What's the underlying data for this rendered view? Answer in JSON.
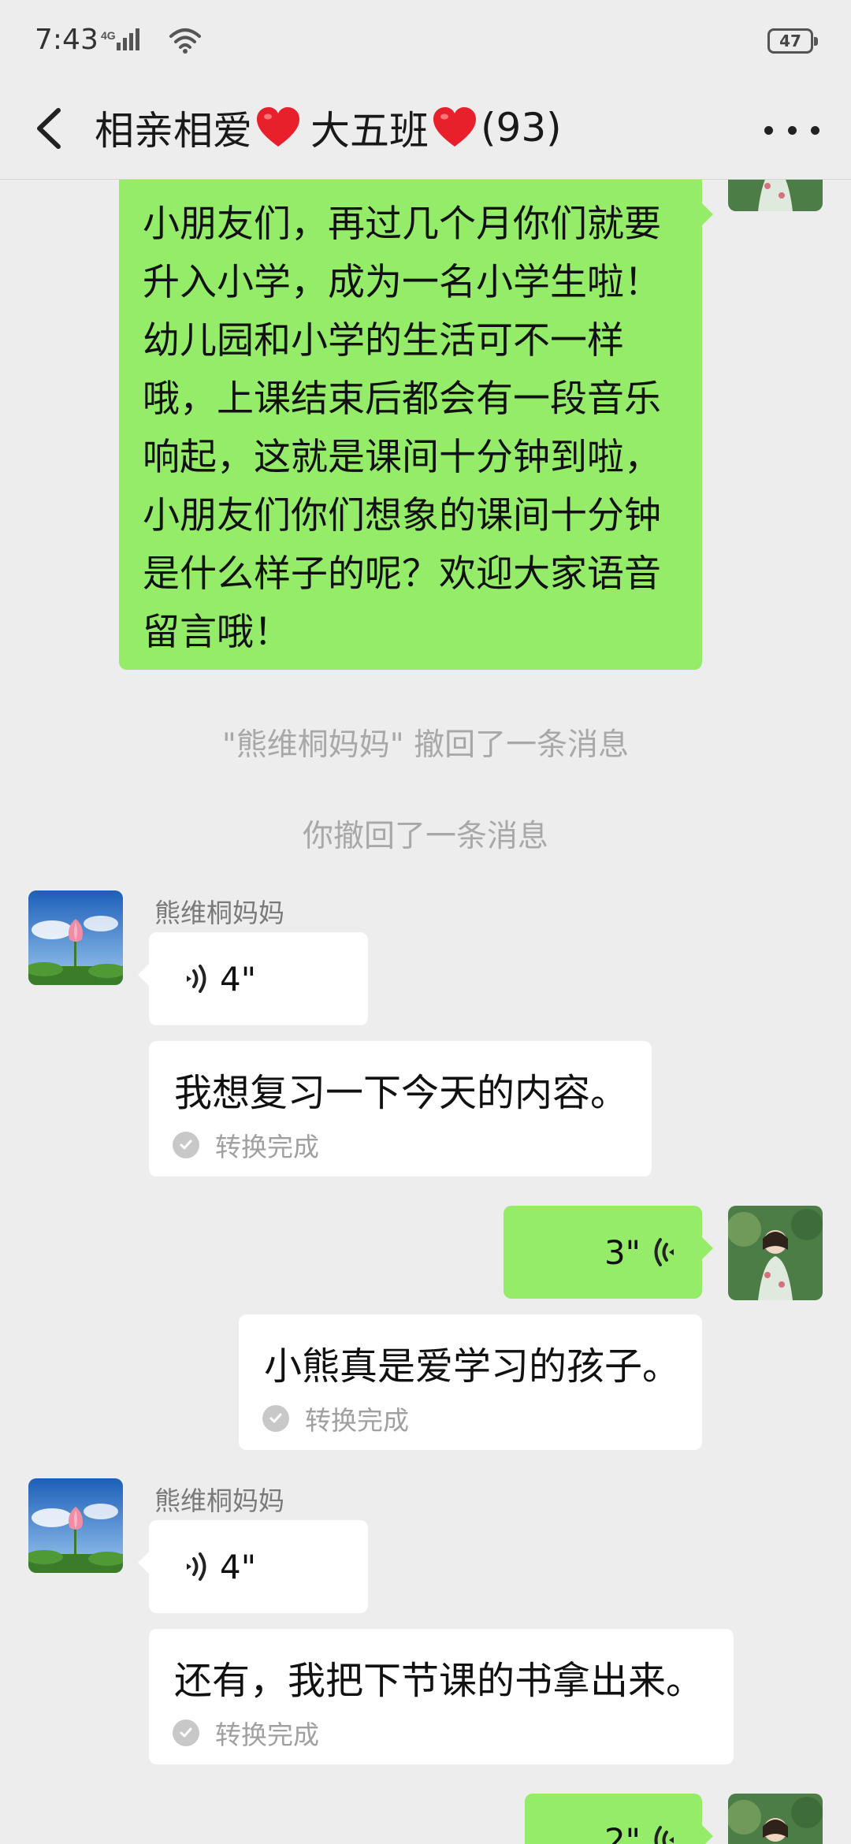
{
  "status_bar": {
    "time": "7:43",
    "network": "4G",
    "battery": "47"
  },
  "header": {
    "title_part1": "相亲相爱",
    "title_part2": "大五班",
    "title_count": "(93)"
  },
  "colors": {
    "background": "#ededed",
    "own_bubble": "#95ec69",
    "other_bubble": "#ffffff",
    "system_text": "#a8a8a8"
  },
  "messages": {
    "m0": {
      "sender": "self",
      "text": "小朋友们，再过几个月你们就要升入小学，成为一名小学生啦！幼儿园和小学的生活可不一样哦，上课结束后都会有一段音乐响起，这就是课间十分钟到啦，小朋友们你们想象的课间十分钟是什么样子的呢？欢迎大家语音留言哦！"
    },
    "sys1": "\"熊维桐妈妈\" 撤回了一条消息",
    "sys2": "你撤回了一条消息",
    "m1": {
      "sender_name": "熊维桐妈妈",
      "voice_duration": "4\"",
      "transcript": "我想复习一下今天的内容。",
      "transcript_status": "转换完成"
    },
    "m2": {
      "sender": "self",
      "voice_duration": "3\"",
      "transcript": "小熊真是爱学习的孩子。",
      "transcript_status": "转换完成"
    },
    "m3": {
      "sender_name": "熊维桐妈妈",
      "voice_duration": "4\"",
      "transcript": "还有，我把下节课的书拿出来。",
      "transcript_status": "转换完成"
    },
    "m4": {
      "sender": "self",
      "voice_duration": "2\""
    }
  }
}
